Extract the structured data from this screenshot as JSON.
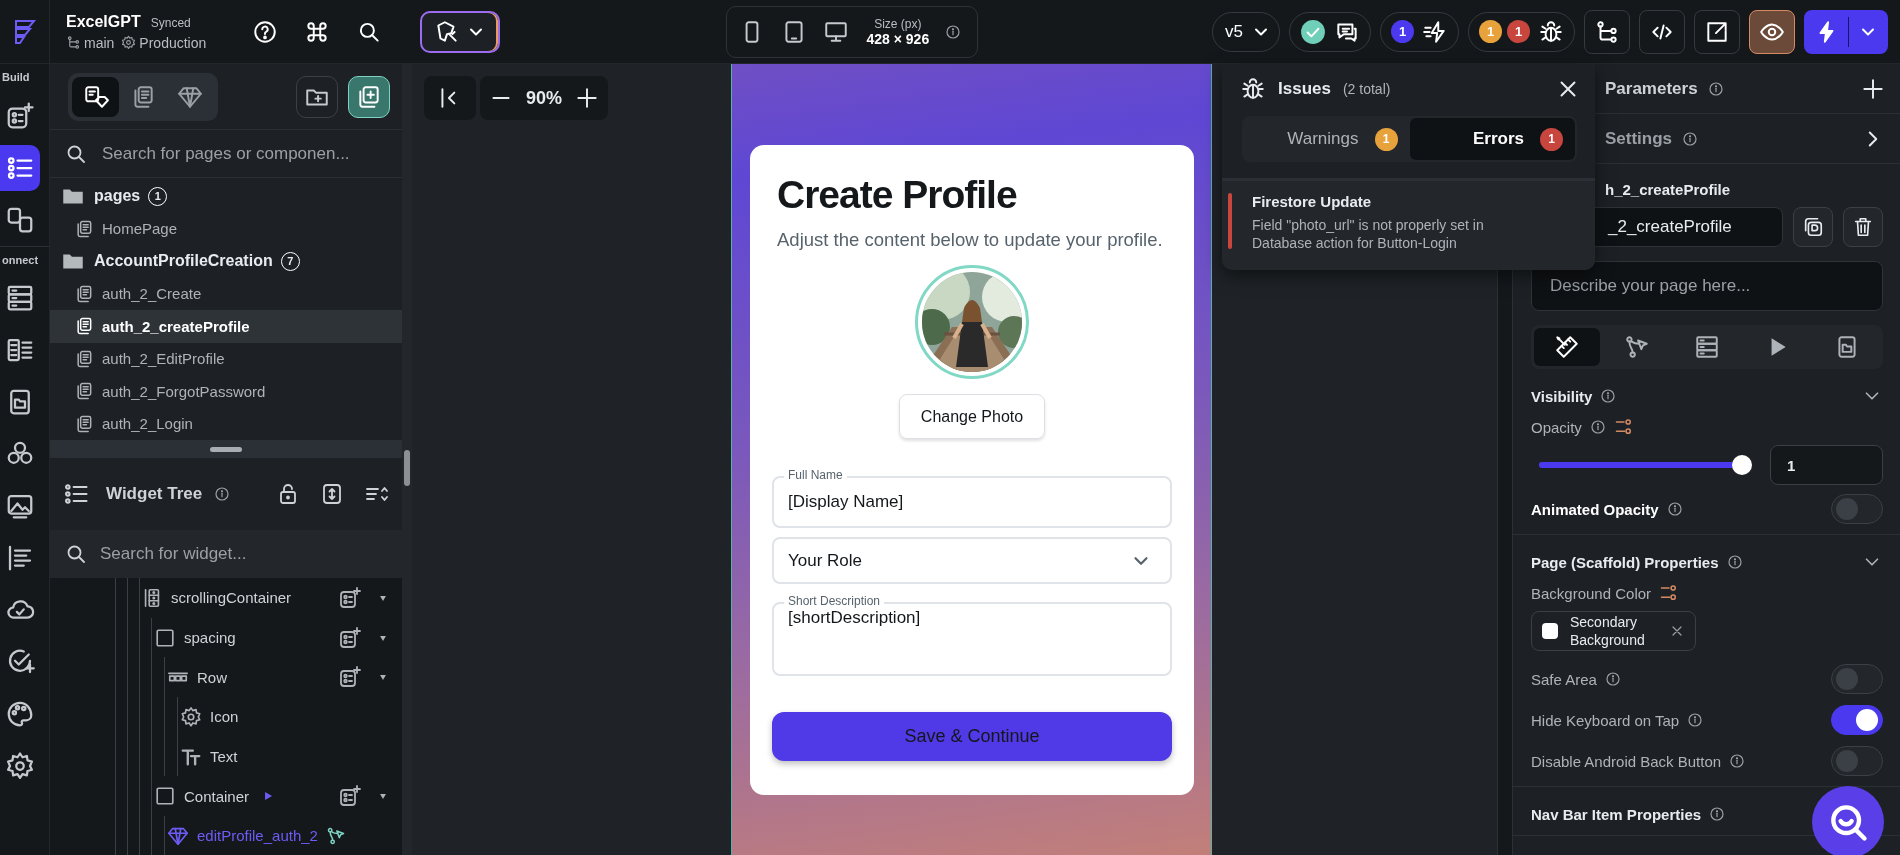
{
  "header": {
    "project_name": "ExcelGPT",
    "sync_status": "Synced",
    "branch": "main",
    "environment": "Production"
  },
  "device_preview": {
    "size_label": "Size (px)",
    "size_value": "428 × 926"
  },
  "toolbar": {
    "version": "v5",
    "agent_count": "1",
    "warning_count": "1",
    "error_count": "1"
  },
  "rail": {
    "groups": [
      {
        "label": "Build",
        "items": [
          {
            "selected": false
          },
          {
            "selected": true
          },
          {
            "selected": false
          }
        ]
      },
      {
        "label": "onnect",
        "items": [
          {
            "selected": false
          },
          {
            "selected": false
          },
          {
            "selected": false
          },
          {
            "selected": false
          },
          {
            "selected": false
          },
          {
            "selected": false
          },
          {
            "selected": false
          },
          {
            "selected": false
          },
          {
            "selected": false
          },
          {
            "selected": false
          }
        ]
      }
    ]
  },
  "page_panel": {
    "tabs": [
      {
        "selected": true
      },
      {
        "selected": false
      },
      {
        "selected": false
      }
    ],
    "search_placeholder": "Search for pages or componen...",
    "folders": [
      {
        "name": "pages",
        "count": "1",
        "children": [
          {
            "name": "HomePage",
            "selected": false
          }
        ]
      },
      {
        "name": "AccountProfileCreation",
        "count": "7",
        "children": [
          {
            "name": "auth_2_Create",
            "selected": false
          },
          {
            "name": "auth_2_createProfile",
            "selected": true
          },
          {
            "name": "auth_2_EditProfile",
            "selected": false
          },
          {
            "name": "auth_2_ForgotPassword",
            "selected": false
          },
          {
            "name": "auth_2_Login",
            "selected": false
          }
        ]
      }
    ]
  },
  "widget_tree": {
    "title": "Widget Tree",
    "search_placeholder": "Search for widget...",
    "nodes": [
      {
        "name": "scrollingContainer",
        "kind": "column",
        "children": [
          {
            "name": "spacing",
            "kind": "container",
            "children": [
              {
                "name": "Row",
                "kind": "row",
                "children": [
                  {
                    "name": "Icon",
                    "kind": "icon"
                  },
                  {
                    "name": "Text",
                    "kind": "text"
                  }
                ]
              }
            ]
          },
          {
            "name": "Container",
            "kind": "container",
            "flagged": true,
            "children": [
              {
                "name": "editProfile_auth_2",
                "kind": "component",
                "has_action": true
              }
            ]
          }
        ]
      }
    ]
  },
  "canvas": {
    "zoom": "90%"
  },
  "phone_preview": {
    "title": "Create Profile",
    "subtitle": "Adjust the content below to update your profile.",
    "photo_button": "Change Photo",
    "fields": [
      {
        "kind": "text",
        "label": "Full Name",
        "value": "[Display Name]"
      },
      {
        "kind": "dropdown",
        "value": "Your Role"
      },
      {
        "kind": "multiline",
        "label": "Short Description",
        "value": "[shortDescription]"
      }
    ],
    "primary_button": "Save & Continue"
  },
  "issues": {
    "title": "Issues",
    "total": "(2 total)",
    "tabs": [
      {
        "label": "Warnings",
        "count": "1",
        "color": "#e8a23c",
        "selected": false
      },
      {
        "label": "Errors",
        "count": "1",
        "color": "#c9463f",
        "selected": true
      }
    ],
    "items": [
      {
        "kind": "error",
        "title": "Firestore Update",
        "message": "Field \"photo_url\" is not properly set in Database action for Button-Login"
      }
    ]
  },
  "properties": {
    "parameters_label": "Parameters",
    "settings_label": "Settings",
    "page_title": "h_2_createProfile",
    "page_name": "_2_createProfile",
    "description_placeholder": "Describe your page here...",
    "tabs": [
      {
        "selected": true
      },
      {
        "selected": false
      },
      {
        "selected": false
      },
      {
        "selected": false
      },
      {
        "selected": false
      }
    ],
    "sections": [
      {
        "title": "Visibility",
        "rows": [
          {
            "kind": "slider",
            "label": "Opacity",
            "level": 1,
            "value": "1"
          },
          {
            "kind": "main_toggle",
            "label": "Animated Opacity",
            "on": false
          }
        ]
      },
      {
        "title": "Page (Scaffold) Properties",
        "rows": [
          {
            "kind": "color",
            "label": "Background Color",
            "color_name": "Secondary Background",
            "color": "#ffffff"
          },
          {
            "kind": "toggle",
            "label": "Safe Area",
            "on": false
          },
          {
            "kind": "toggle",
            "label": "Hide Keyboard on Tap",
            "on": true
          },
          {
            "kind": "toggle",
            "label": "Disable Android Back Button",
            "on": false
          }
        ]
      },
      {
        "title": "Nav Bar Item Properties"
      }
    ]
  }
}
